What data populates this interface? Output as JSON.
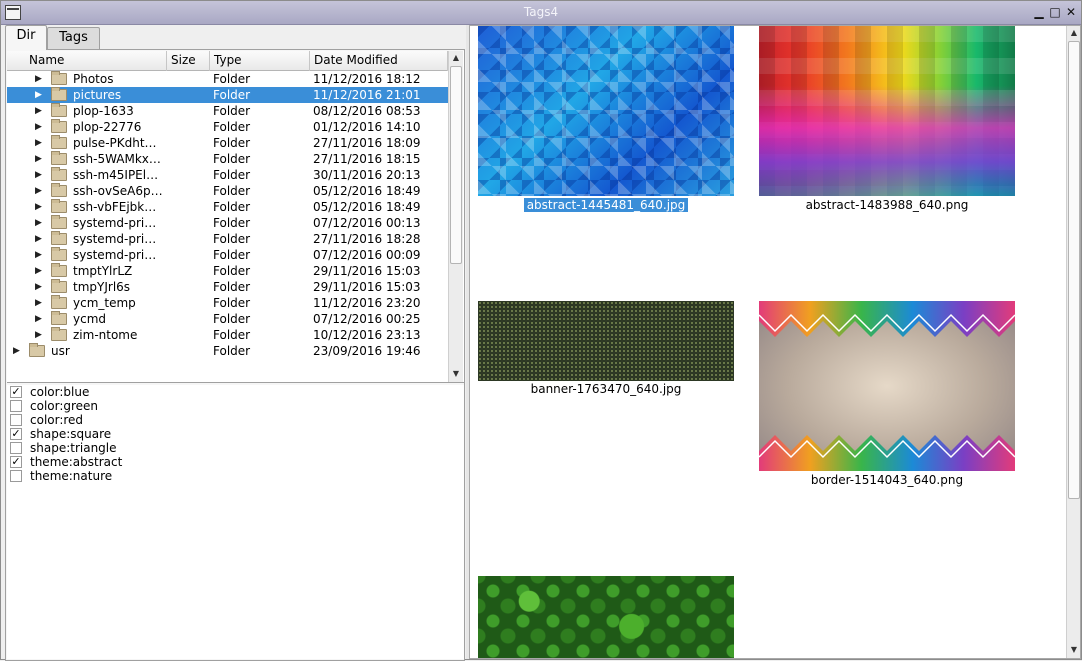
{
  "window": {
    "title": "Tags4"
  },
  "tabs": [
    {
      "label": "Dir"
    },
    {
      "label": "Tags"
    }
  ],
  "tree": {
    "columns": [
      "Name",
      "Size",
      "Type",
      "Date Modified"
    ],
    "rows": [
      {
        "name": "Photos",
        "type": "Folder",
        "date": "11/12/2016 18:12",
        "level": 1,
        "selected": false
      },
      {
        "name": "pictures",
        "type": "Folder",
        "date": "11/12/2016 21:01",
        "level": 1,
        "selected": true
      },
      {
        "name": "plop-1633",
        "type": "Folder",
        "date": "08/12/2016 08:53",
        "level": 1,
        "selected": false
      },
      {
        "name": "plop-22776",
        "type": "Folder",
        "date": "01/12/2016 14:10",
        "level": 1,
        "selected": false
      },
      {
        "name": "pulse-PKdht…",
        "type": "Folder",
        "date": "27/11/2016 18:09",
        "level": 1,
        "selected": false
      },
      {
        "name": "ssh-5WAMkx…",
        "type": "Folder",
        "date": "27/11/2016 18:15",
        "level": 1,
        "selected": false
      },
      {
        "name": "ssh-m45IPEl…",
        "type": "Folder",
        "date": "30/11/2016 20:13",
        "level": 1,
        "selected": false
      },
      {
        "name": "ssh-ovSeA6p…",
        "type": "Folder",
        "date": "05/12/2016 18:49",
        "level": 1,
        "selected": false
      },
      {
        "name": "ssh-vbFEjbk…",
        "type": "Folder",
        "date": "05/12/2016 18:49",
        "level": 1,
        "selected": false
      },
      {
        "name": "systemd-pri…",
        "type": "Folder",
        "date": "07/12/2016 00:13",
        "level": 1,
        "selected": false
      },
      {
        "name": "systemd-pri…",
        "type": "Folder",
        "date": "27/11/2016 18:28",
        "level": 1,
        "selected": false
      },
      {
        "name": "systemd-pri…",
        "type": "Folder",
        "date": "07/12/2016 00:09",
        "level": 1,
        "selected": false
      },
      {
        "name": "tmptYlrLZ",
        "type": "Folder",
        "date": "29/11/2016 15:03",
        "level": 1,
        "selected": false
      },
      {
        "name": "tmpYJrl6s",
        "type": "Folder",
        "date": "29/11/2016 15:03",
        "level": 1,
        "selected": false
      },
      {
        "name": "ycm_temp",
        "type": "Folder",
        "date": "11/12/2016 23:20",
        "level": 1,
        "selected": false
      },
      {
        "name": "ycmd",
        "type": "Folder",
        "date": "07/12/2016 00:25",
        "level": 1,
        "selected": false
      },
      {
        "name": "zim-ntome",
        "type": "Folder",
        "date": "10/12/2016 23:13",
        "level": 1,
        "selected": false
      },
      {
        "name": "usr",
        "type": "Folder",
        "date": "23/09/2016 19:46",
        "level": 0,
        "selected": false
      }
    ]
  },
  "tags": [
    {
      "label": "color:blue",
      "checked": true
    },
    {
      "label": "color:green",
      "checked": false
    },
    {
      "label": "color:red",
      "checked": false
    },
    {
      "label": "shape:square",
      "checked": true
    },
    {
      "label": "shape:triangle",
      "checked": false
    },
    {
      "label": "theme:abstract",
      "checked": true
    },
    {
      "label": "theme:nature",
      "checked": false
    }
  ],
  "images": [
    {
      "caption": "abstract-1445481_640.jpg",
      "selected": true,
      "icon": "blue-abstract-squares"
    },
    {
      "caption": "abstract-1483988_640.png",
      "selected": false,
      "icon": "rainbow-mosaic"
    },
    {
      "caption": "banner-1763470_640.jpg",
      "selected": false,
      "icon": "dark-green-dots"
    },
    {
      "caption": "border-1514043_640.png",
      "selected": false,
      "icon": "triangle-border"
    },
    {
      "caption": "",
      "selected": false,
      "icon": "clover-field"
    }
  ],
  "colors": {
    "selection": "#3a8ed8",
    "titlebar": "#b6b5cf"
  }
}
